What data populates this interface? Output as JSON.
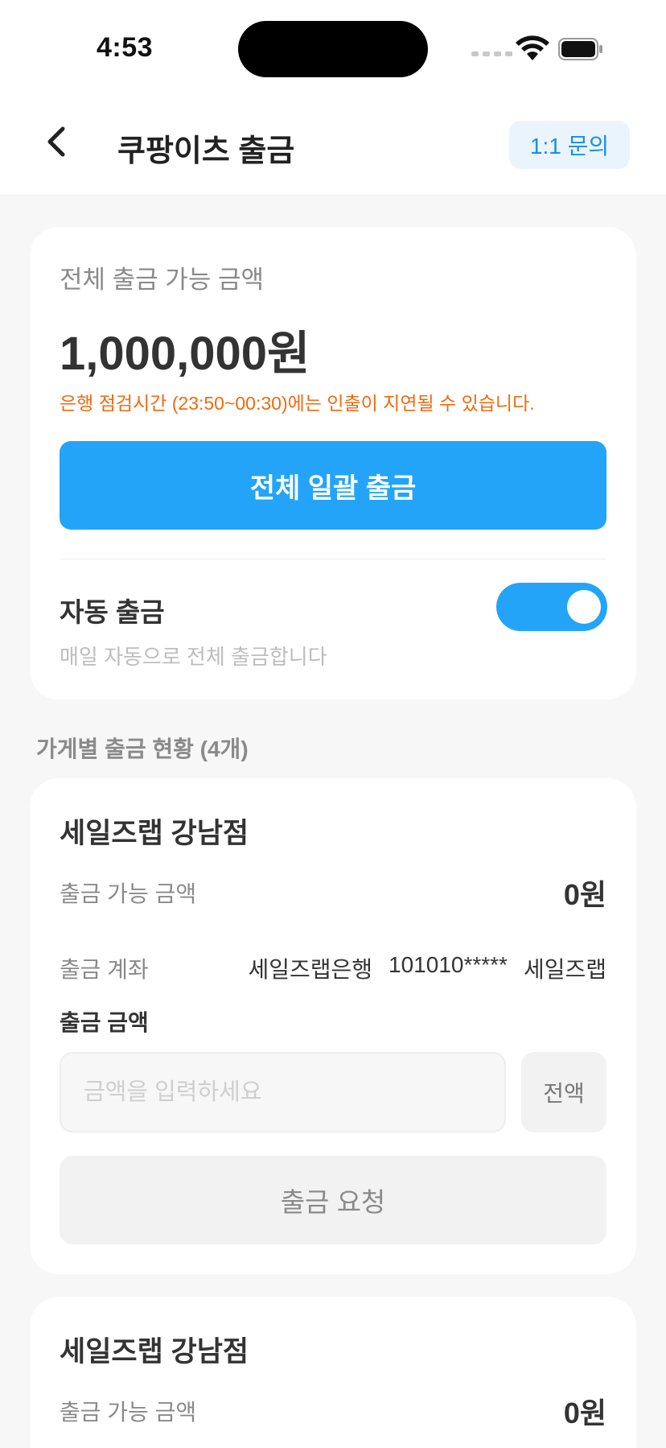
{
  "status_bar": {
    "time": "4:53"
  },
  "header": {
    "title": "쿠팡이츠 출금",
    "inquiry_label": "1:1 문의"
  },
  "summary": {
    "label": "전체 출금 가능 금액",
    "total_amount": "1,000,000원",
    "notice": "은행 점검시간 (23:50~00:30)에는 인출이 지연될 수 있습니다.",
    "bulk_button_label": "전체 일괄 출금",
    "auto_withdraw": {
      "title": "자동 출금",
      "description": "매일 자동으로 전체 출금합니다",
      "enabled": true
    }
  },
  "stores_section": {
    "title": "가게별 출금 현황 (4개)"
  },
  "stores": [
    {
      "name": "세일즈랩 강남점",
      "available_label": "출금 가능 금액",
      "available_amount": "0원",
      "account_label": "출금 계좌",
      "bank": "세일즈랩은행",
      "account_number": "101010*****",
      "account_holder": "세일즈랩",
      "amount_label": "출금 금액",
      "amount_placeholder": "금액을 입력하세요",
      "all_button_label": "전액",
      "request_button_label": "출금 요청"
    },
    {
      "name": "세일즈랩 강남점",
      "available_label": "출금 가능 금액",
      "available_amount": "0원"
    }
  ],
  "colors": {
    "accent": "#23a4f8",
    "notice": "#f06a0f",
    "background": "#f7f7f7"
  }
}
